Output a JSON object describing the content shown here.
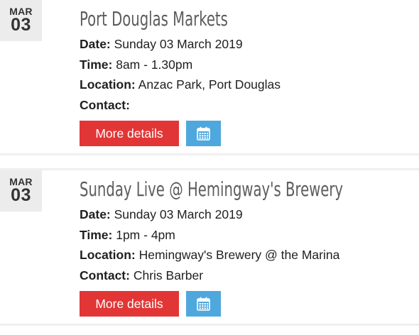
{
  "events": [
    {
      "month": "MAR",
      "day": "03",
      "title": "Port Douglas Markets",
      "date_label": "Date:",
      "date_value": " Sunday 03 March 2019",
      "time_label": "Time:",
      "time_value": " 8am - 1.30pm",
      "location_label": "Location:",
      "location_value": " Anzac Park, Port Douglas",
      "contact_label": "Contact:",
      "contact_value": "",
      "more_label": "More details",
      "calendar_icon": "calendar-icon"
    },
    {
      "month": "MAR",
      "day": "03",
      "title": "Sunday Live @ Hemingway's Brewery",
      "date_label": "Date:",
      "date_value": " Sunday 03 March 2019",
      "time_label": "Time:",
      "time_value": " 1pm - 4pm",
      "location_label": "Location:",
      "location_value": " Hemingway's Brewery @ the Marina",
      "contact_label": "Contact:",
      "contact_value": " Chris Barber",
      "more_label": "More details",
      "calendar_icon": "calendar-icon"
    }
  ],
  "colors": {
    "more_button": "#e23636",
    "calendar_button": "#4ea8dd",
    "date_box": "#ececec",
    "title_text": "#5d5d5d"
  }
}
